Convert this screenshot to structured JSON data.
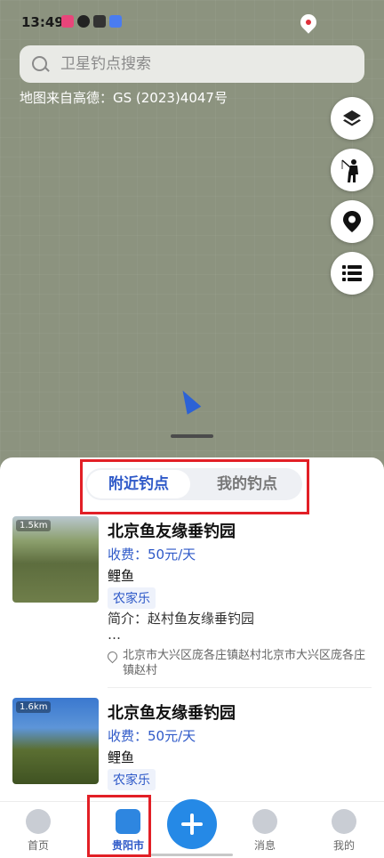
{
  "status_bar": {
    "time": "13:49"
  },
  "search": {
    "placeholder": "卫星钓点搜索"
  },
  "map": {
    "source_text": "地图来自高德：GS (2023)4047号"
  },
  "map_controls": [
    {
      "icon": "layers-icon"
    },
    {
      "icon": "angler-icon"
    },
    {
      "icon": "location-pin-icon"
    },
    {
      "icon": "list-icon"
    }
  ],
  "tabs": {
    "nearby": "附近钓点",
    "mine": "我的钓点",
    "active": "nearby"
  },
  "spots": [
    {
      "distance": "1.5km",
      "title": "北京鱼友缘垂钓园",
      "fee": "收费：50元/天",
      "fish": "鲤鱼",
      "tag": "农家乐",
      "desc_line1": "简介：赵村鱼友缘垂钓园",
      "desc_line2": "…",
      "address": "北京市大兴区庞各庄镇赵村北京市大兴区庞各庄镇赵村"
    },
    {
      "distance": "1.6km",
      "title": "北京鱼友缘垂钓园",
      "fee": "收费：50元/天",
      "fish": "鲤鱼",
      "tag": "农家乐"
    }
  ],
  "bottom_nav": {
    "home": "首页",
    "city": "贵阳市",
    "messages": "消息",
    "me": "我的"
  },
  "colors": {
    "accent": "#2e59c8",
    "fab": "#2589e6",
    "highlight": "#e21f26"
  }
}
